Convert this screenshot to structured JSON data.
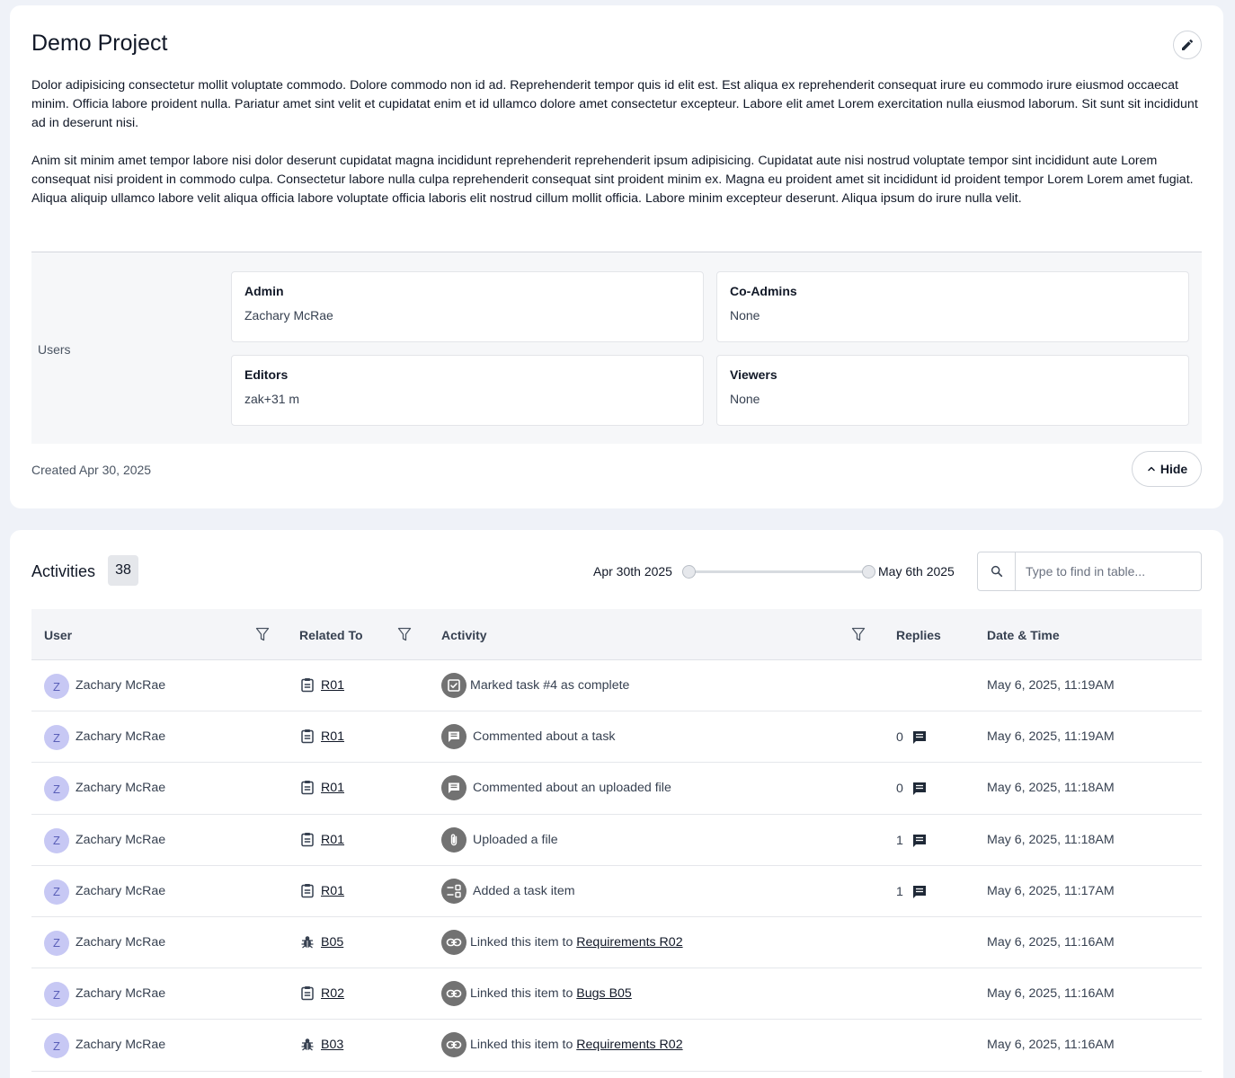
{
  "project": {
    "title": "Demo Project",
    "description": [
      "Dolor adipisicing consectetur mollit voluptate commodo. Dolore commodo non id ad. Reprehenderit tempor quis id elit est. Est aliqua ex reprehenderit consequat irure eu commodo irure eiusmod occaecat minim. Officia labore proident nulla. Pariatur amet sint velit et cupidatat enim et id ullamco dolore amet consectetur excepteur. Labore elit amet Lorem exercitation nulla eiusmod laborum. Sit sunt sit incididunt ad in deserunt nisi.",
      "Anim sit minim amet tempor labore nisi dolor deserunt cupidatat magna incididunt reprehenderit reprehenderit ipsum adipisicing. Cupidatat aute nisi nostrud voluptate tempor sint incididunt aute Lorem consequat nisi proident in commodo culpa. Consectetur labore nulla culpa reprehenderit consequat sint proident minim ex. Magna eu proident amet sit incididunt id proident tempor Lorem Lorem amet fugiat. Aliqua aliquip ullamco labore velit aliqua officia labore voluptate officia laboris elit nostrud cillum mollit officia. Labore minim excepteur deserunt. Aliqua ipsum do irure nulla velit."
    ],
    "users_label": "Users",
    "roles": {
      "admin": {
        "title": "Admin",
        "value": "Zachary McRae"
      },
      "co_admins": {
        "title": "Co-Admins",
        "value": "None"
      },
      "editors": {
        "title": "Editors",
        "value": "zak+31 m"
      },
      "viewers": {
        "title": "Viewers",
        "value": "None"
      }
    },
    "created": "Created Apr 30, 2025",
    "hide_label": "Hide"
  },
  "activities": {
    "title": "Activities",
    "count": "38",
    "range_start": "Apr 30th 2025",
    "range_end": "May 6th 2025",
    "search_placeholder": "Type to find in table...",
    "columns": {
      "user": "User",
      "related": "Related To",
      "activity": "Activity",
      "replies": "Replies",
      "date": "Date & Time"
    },
    "rows": [
      {
        "avatar": "Z",
        "user": "Zachary McRae",
        "related_icon": "clipboard-icon",
        "related": "R01",
        "activity_icon": "checkbox-icon",
        "activity": "Marked task #4 as complete",
        "link": "",
        "replies": "",
        "date": "May 6, 2025, 11:19AM"
      },
      {
        "avatar": "Z",
        "user": "Zachary McRae",
        "related_icon": "clipboard-icon",
        "related": "R01",
        "activity_icon": "comment-icon",
        "activity": "Commented about a task",
        "link": "",
        "replies": "0",
        "date": "May 6, 2025, 11:19AM"
      },
      {
        "avatar": "Z",
        "user": "Zachary McRae",
        "related_icon": "clipboard-icon",
        "related": "R01",
        "activity_icon": "comment-icon",
        "activity": "Commented about an uploaded file",
        "link": "",
        "replies": "0",
        "date": "May 6, 2025, 11:18AM"
      },
      {
        "avatar": "Z",
        "user": "Zachary McRae",
        "related_icon": "clipboard-icon",
        "related": "R01",
        "activity_icon": "paperclip-icon",
        "activity": "Uploaded a file",
        "link": "",
        "replies": "1",
        "date": "May 6, 2025, 11:18AM"
      },
      {
        "avatar": "Z",
        "user": "Zachary McRae",
        "related_icon": "clipboard-icon",
        "related": "R01",
        "activity_icon": "task-list-icon",
        "activity": "Added a task item",
        "link": "",
        "replies": "1",
        "date": "May 6, 2025, 11:17AM"
      },
      {
        "avatar": "Z",
        "user": "Zachary McRae",
        "related_icon": "bug-icon",
        "related": "B05",
        "activity_icon": "link-icon",
        "activity": "Linked this item to ",
        "link": "Requirements R02",
        "replies": "",
        "date": "May 6, 2025, 11:16AM"
      },
      {
        "avatar": "Z",
        "user": "Zachary McRae",
        "related_icon": "clipboard-icon",
        "related": "R02",
        "activity_icon": "link-icon",
        "activity": "Linked this item to ",
        "link": "Bugs B05",
        "replies": "",
        "date": "May 6, 2025, 11:16AM"
      },
      {
        "avatar": "Z",
        "user": "Zachary McRae",
        "related_icon": "bug-icon",
        "related": "B03",
        "activity_icon": "link-icon",
        "activity": "Linked this item to ",
        "link": "Requirements R02",
        "replies": "",
        "date": "May 6, 2025, 11:16AM"
      }
    ]
  }
}
